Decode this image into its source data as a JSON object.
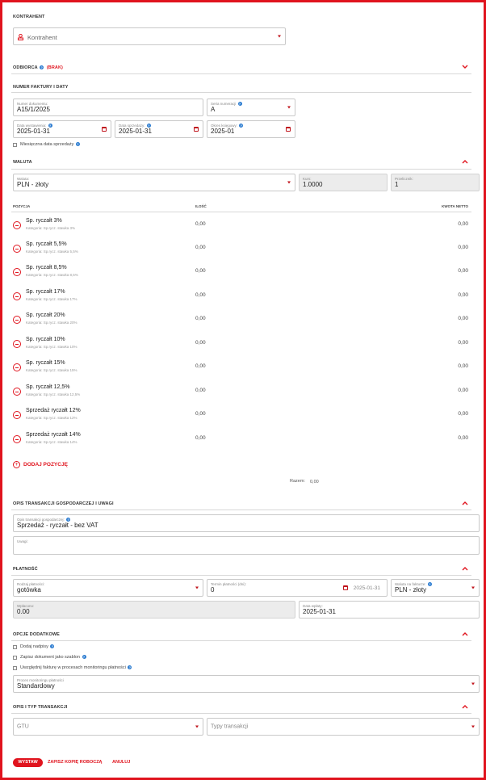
{
  "kontrahent": {
    "section": "KONTRAHENT",
    "placeholder": "Kontrahent"
  },
  "odbiorca": {
    "section": "ODBIORCA",
    "badge": "(BRAK)"
  },
  "numer": {
    "section": "NUMER FAKTURY I DATY",
    "nr_dok_label": "Numer dokumentu:",
    "nr_dok_value": "A15/1/2025",
    "seria_label": "Seria numeracji",
    "seria_value": "A",
    "data_wyst_label": "Data wystawienia:",
    "data_wyst_value": "2025-01-31",
    "data_sprz_label": "Data sprzedaży:",
    "data_sprz_value": "2025-01-31",
    "okres_label": "Okres księgowy:",
    "okres_value": "2025-01",
    "miesieczna": "Miesięczna data sprzedaży"
  },
  "waluta": {
    "section": "WALUTA",
    "waluta_label": "Waluta:",
    "waluta_value": "PLN - złoty",
    "kurs_label": "Kurs:",
    "kurs_value": "1.0000",
    "przelicznik_label": "Przelicznik:",
    "przelicznik_value": "1"
  },
  "pozycje": {
    "col_pozycja": "POZYCJA",
    "col_ilosc": "ILOŚĆ",
    "col_kwota": "KWOTA NETTO",
    "rows": [
      {
        "name": "Sp. ryczałt 3%",
        "sub": "Kategoria: Sp.rycz. stawka 3%",
        "ilosc": "0,00",
        "kwota": "0,00"
      },
      {
        "name": "Sp. ryczałt 5,5%",
        "sub": "Kategoria: Sp.rycz. stawka 5,5%",
        "ilosc": "0,00",
        "kwota": "0,00"
      },
      {
        "name": "Sp. ryczałt 8,5%",
        "sub": "Kategoria: Sp.rycz. stawka 8,5%",
        "ilosc": "0,00",
        "kwota": "0,00"
      },
      {
        "name": "Sp. ryczałt 17%",
        "sub": "Kategoria: Sp.rycz. stawka 17%",
        "ilosc": "0,00",
        "kwota": "0,00"
      },
      {
        "name": "Sp. ryczałt 20%",
        "sub": "Kategoria: Sp.rycz. stawka 20%",
        "ilosc": "0,00",
        "kwota": "0,00"
      },
      {
        "name": "Sp. ryczałt 10%",
        "sub": "Kategoria: Sp.rycz. stawka 10%",
        "ilosc": "0,00",
        "kwota": "0,00"
      },
      {
        "name": "Sp. ryczałt 15%",
        "sub": "Kategoria: Sp.rycz. stawka 15%",
        "ilosc": "0,00",
        "kwota": "0,00"
      },
      {
        "name": "Sp. ryczałt 12,5%",
        "sub": "Kategoria: Sp.rycz. stawka 12,5%",
        "ilosc": "0,00",
        "kwota": "0,00"
      },
      {
        "name": "Sprzedaż ryczałt 12%",
        "sub": "Kategoria: Sp.rycz. stawka 12%",
        "ilosc": "0,00",
        "kwota": "0,00"
      },
      {
        "name": "Sprzedaż ryczałt 14%",
        "sub": "Kategoria: Sp.rycz. stawka 14%",
        "ilosc": "0,00",
        "kwota": "0,00"
      }
    ],
    "add_label": "DODAJ POZYCJĘ",
    "razem_label": "Razem:",
    "razem_value": "0,00"
  },
  "opis": {
    "section": "OPIS TRANSAKCJI GOSPODARCZEJ I UWAGI",
    "opis_label": "Opis transakcji gospodarczej:",
    "opis_value": "Sprzedaż - ryczałt - bez VAT",
    "uwagi_label": "Uwagi:"
  },
  "platnosc": {
    "section": "PŁATNOŚĆ",
    "rodzaj_label": "Rodzaj płatności:",
    "rodzaj_value": "gotówka",
    "termin_label": "Termin płatności (dni):",
    "termin_value": "0",
    "termin_date": "2025-01-31",
    "waluta_label": "Waluta na fakturze:",
    "waluta_value": "PLN - złoty",
    "wplacono_label": "Wpłacono:",
    "wplacono_value": "0.00",
    "data_wplaty_label": "Data wpłaty:",
    "data_wplaty_value": "2025-01-31"
  },
  "opcje": {
    "section": "OPCJE DODATKOWE",
    "nadpis": "Dodaj nadpisy",
    "szablon": "Zapisz dokument jako szablon",
    "monitoring": "Uwzględnij fakturę w procesach monitoringu płatności",
    "proces_label": "Proces monitoringu płatności",
    "proces_value": "Standardowy"
  },
  "typ": {
    "section": "OPIS I TYP TRANSAKCJI",
    "gtu": "GTU",
    "typy": "Typy transakcji"
  },
  "footer": {
    "wystaw": "WYSTAW",
    "zapisz": "ZAPISZ KOPIĘ ROBOCZĄ",
    "anuluj": "ANULUJ"
  },
  "colors": {
    "accent": "#e0141e",
    "help": "#2a7bd0",
    "field_border": "#c9c9c9",
    "disabled_bg": "#ececec"
  }
}
